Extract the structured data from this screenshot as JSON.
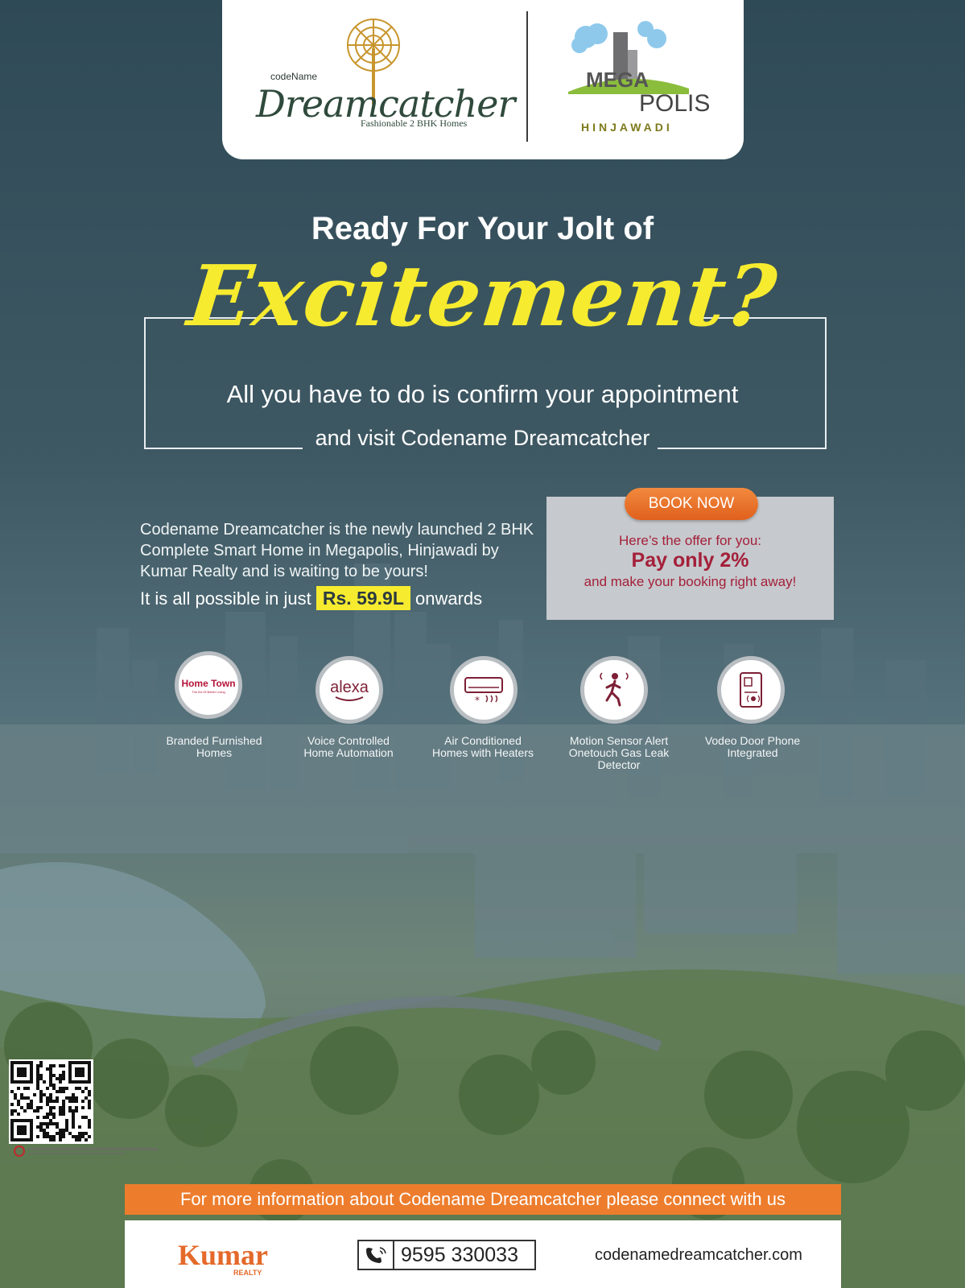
{
  "logos": {
    "dreamcatcher": {
      "prefix": "codeName",
      "name": "Dreamcatcher",
      "tagline": "Fashionable 2 BHK Homes"
    },
    "megapolis": {
      "brand_art": "MEGA",
      "name": "POLIS",
      "location": "HINJAWADI"
    }
  },
  "hero": {
    "headline": "Ready For Your Jolt of",
    "emphasis": "Excitement?",
    "line1": "All you have to do is confirm your appointment",
    "line2": "and visit Codename Dreamcatcher"
  },
  "description": {
    "text": "Codename Dreamcatcher is the newly launched 2 BHK Complete Smart Home in Megapolis, Hinjawadi by Kumar Realty and is waiting to be yours!",
    "price_prefix": "It is all possible in just",
    "price": "Rs. 59.9L",
    "price_suffix": "onwards"
  },
  "offer": {
    "button": "BOOK NOW",
    "line1": "Here’s the offer for you:",
    "line2": "Pay only 2%",
    "line3": "and make your booking right away!"
  },
  "features": [
    {
      "icon": "home-town-logo",
      "logo_text": "Home Town",
      "logo_sub": "The Art Of Better Living",
      "label": "Branded Furnished Homes"
    },
    {
      "icon": "alexa-logo",
      "logo_text": "alexa",
      "label": "Voice Controlled Home Automation"
    },
    {
      "icon": "air-conditioner-icon",
      "label": "Air Conditioned Homes with Heaters"
    },
    {
      "icon": "motion-sensor-icon",
      "label": "Motion Sensor Alert Onetouch Gas Leak Detector"
    },
    {
      "icon": "door-phone-icon",
      "label": "Vodeo Door Phone Integrated"
    }
  ],
  "footer": {
    "info": "For more information about Codename Dreamcatcher please connect with us",
    "brand": "Kumar",
    "brand_sub": "REALTY",
    "phone": "9595 330033",
    "website": "codenamedreamcatcher.com"
  },
  "colors": {
    "accent_yellow": "#f6eb2f",
    "offer_red": "#a4203a",
    "orange": "#ed7d2d",
    "overlay_teal": "#4a5e66"
  }
}
